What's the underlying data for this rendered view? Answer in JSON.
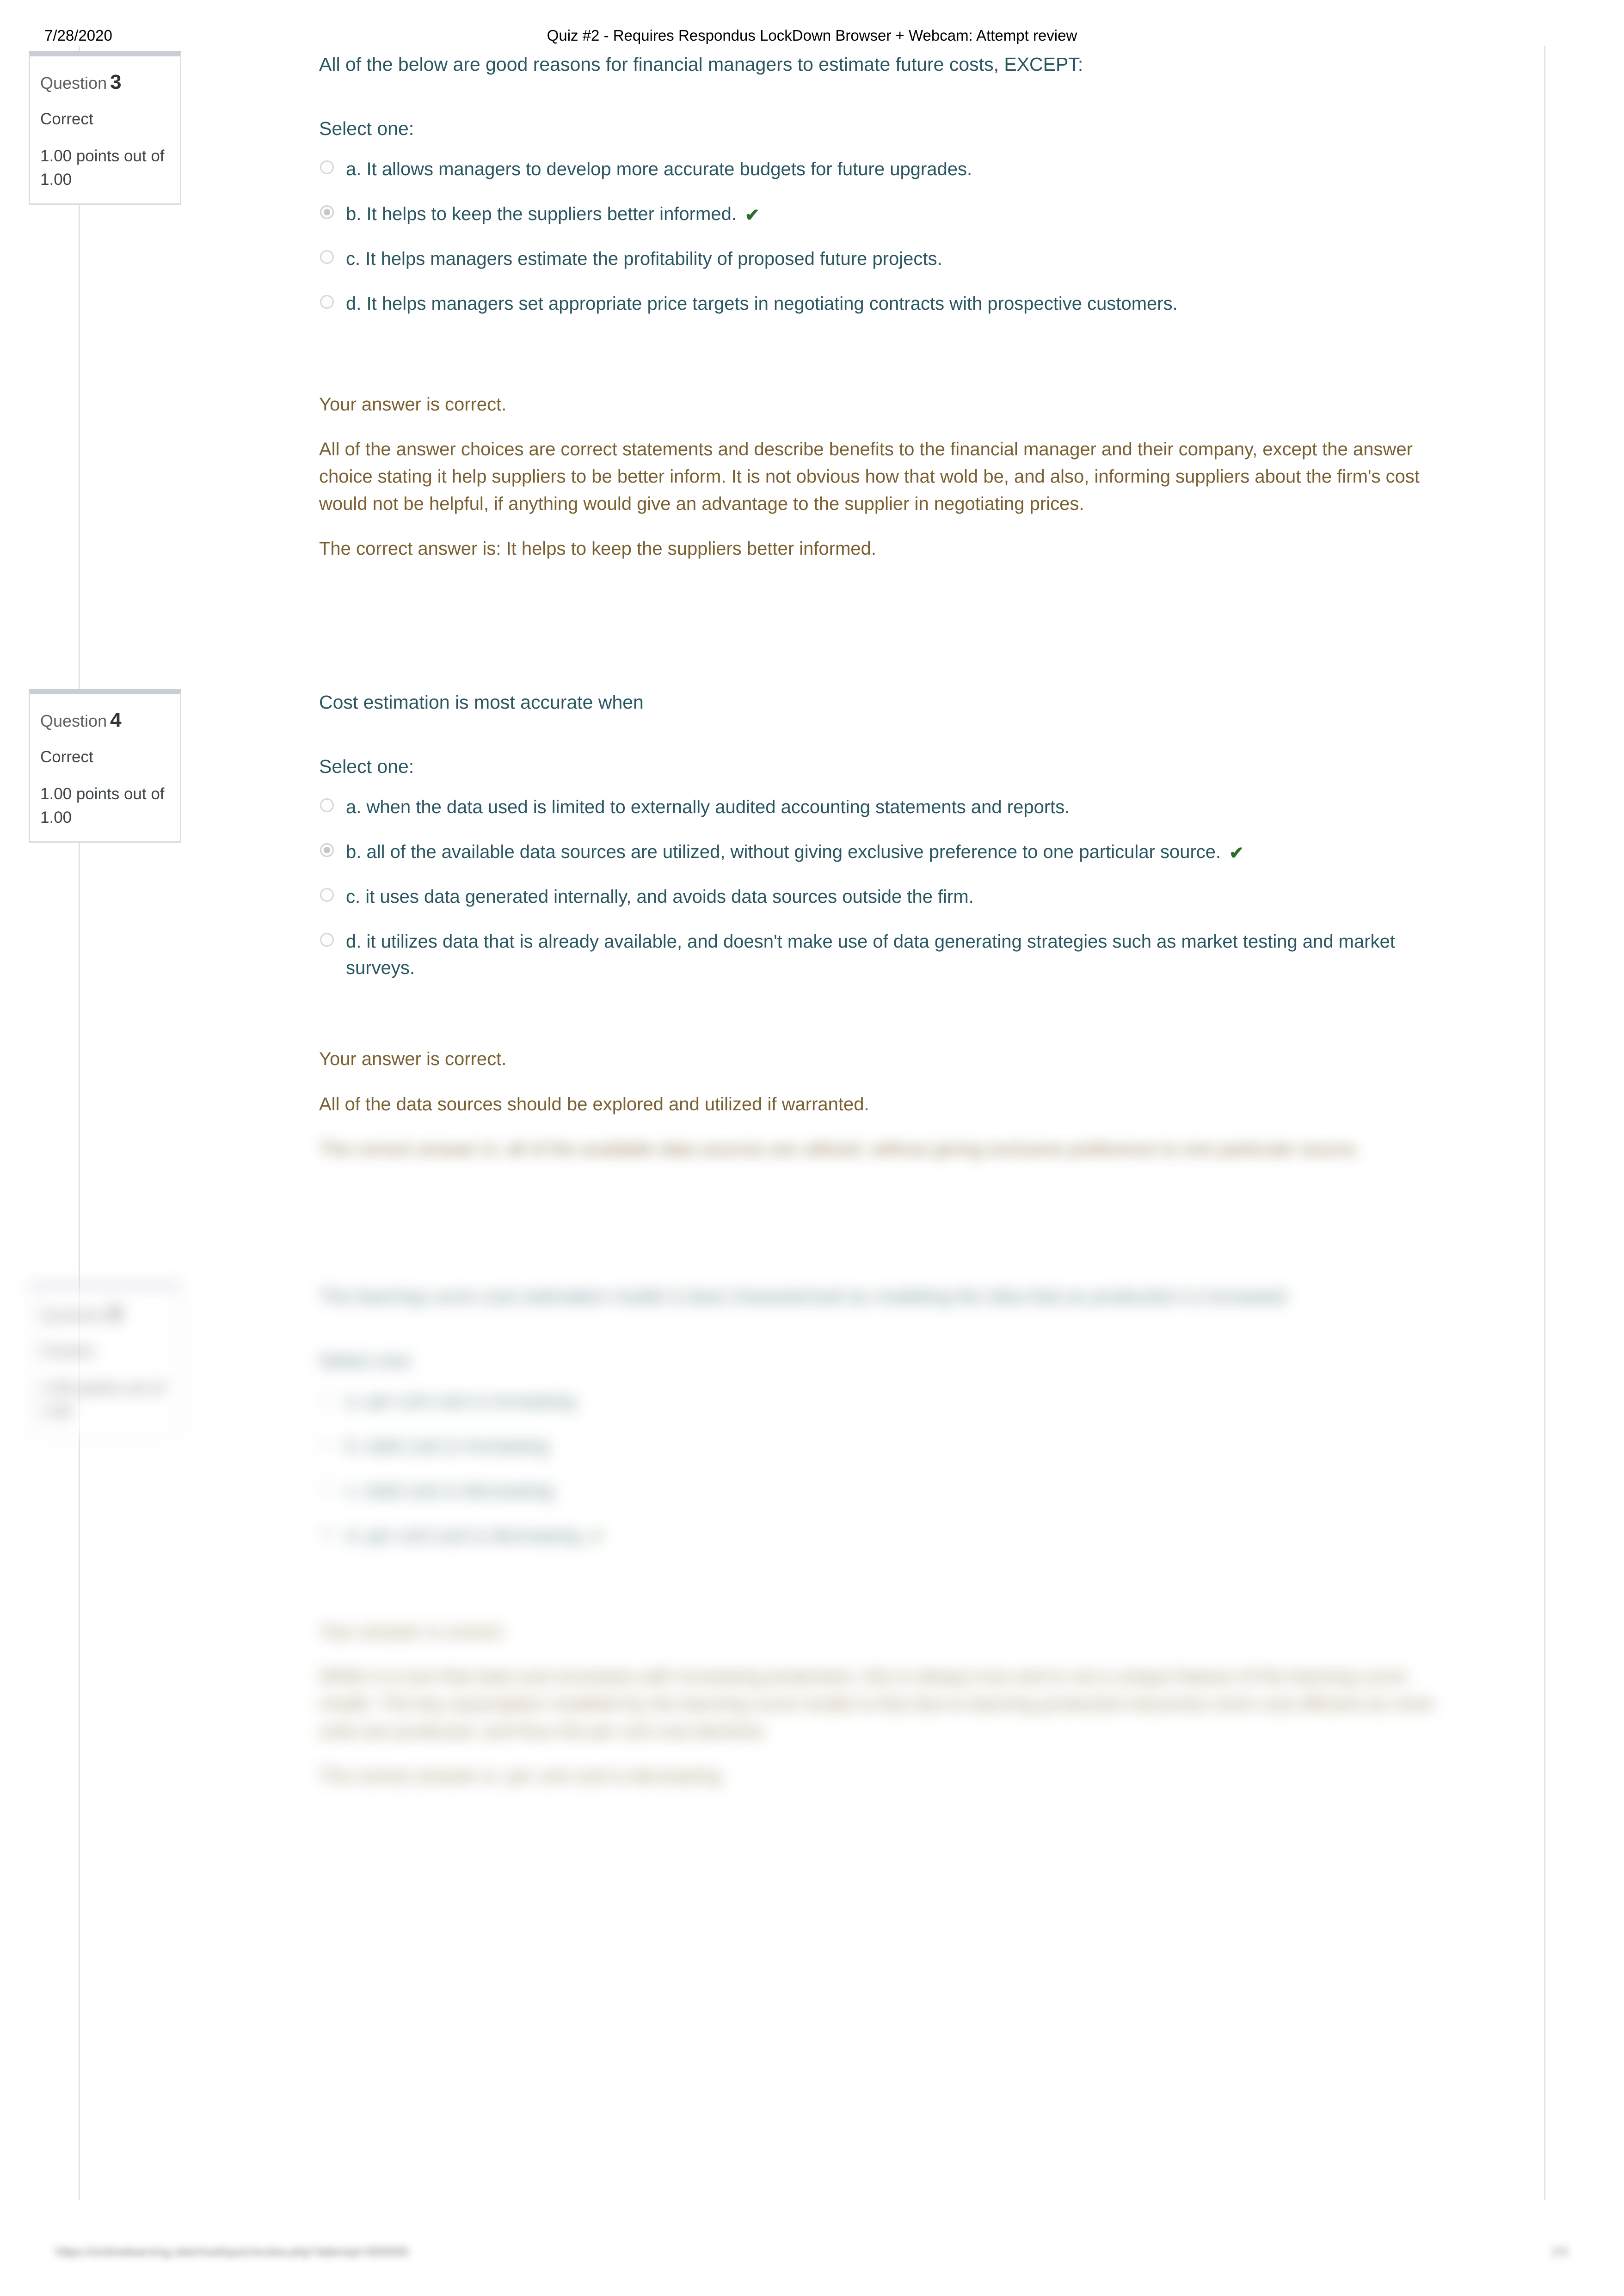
{
  "print_header": {
    "date": "7/28/2020",
    "title": "Quiz #2 - Requires Respondus LockDown Browser + Webcam: Attempt review"
  },
  "print_footer": {
    "url": "https://onlinelearning.site/mod/quiz/review.php?attempt=000000",
    "page": "2/5"
  },
  "labels": {
    "select_one": "Select one:",
    "question_word": "Question",
    "checkmark": "✔"
  },
  "questions": [
    {
      "number": "3",
      "state": "Correct",
      "grade": "1.00 points out of 1.00",
      "text": "All of the below are good reasons for financial managers to estimate future costs, EXCEPT:",
      "select_one": "Select one:",
      "options": [
        {
          "label": "a. It allows managers to develop more accurate budgets for future upgrades.",
          "selected": false,
          "correct_mark": false
        },
        {
          "label": "b. It helps to keep the suppliers better informed.",
          "selected": true,
          "correct_mark": true
        },
        {
          "label": "c. It helps managers estimate the profitability of proposed future projects.",
          "selected": false,
          "correct_mark": false
        },
        {
          "label": "d. It helps managers set appropriate price targets in negotiating contracts with prospective customers.",
          "selected": false,
          "correct_mark": false
        }
      ],
      "feedback": [
        "Your answer is correct.",
        "All of the answer choices are correct statements and describe benefits to the financial manager and their company, except the answer choice stating it help suppliers to be better inform. It is not obvious how that wold be, and also, informing suppliers about the firm's cost would not be helpful, if anything would give an advantage to the supplier in negotiating prices.",
        "The correct answer is: It helps to keep the suppliers better informed."
      ]
    },
    {
      "number": "4",
      "state": "Correct",
      "grade": "1.00 points out of 1.00",
      "text": "Cost estimation is most accurate when",
      "select_one": "Select one:",
      "options": [
        {
          "label": "a. when the data used is limited to externally audited accounting statements and reports.",
          "selected": false,
          "correct_mark": false
        },
        {
          "label": "b. all of the available data sources are utilized, without giving exclusive preference to one particular source.",
          "selected": true,
          "correct_mark": true
        },
        {
          "label": "c. it uses data generated internally, and avoids data sources outside the firm.",
          "selected": false,
          "correct_mark": false
        },
        {
          "label": "d. it utilizes data that is already available, and doesn't make use of data generating strategies such as market testing and market surveys.",
          "selected": false,
          "correct_mark": false
        }
      ],
      "feedback": [
        "Your answer is correct.",
        "All of the data sources should be explored and utilized if warranted.",
        "The correct answer is: all of the available data sources are utilized, without giving exclusive preference to one particular source."
      ]
    },
    {
      "number": "5",
      "state": "Correct",
      "grade": "1.00 points out of 1.00",
      "text": "The learning curve cost estimation model is best characterized as modeling the idea that as production is increased",
      "select_one": "Select one:",
      "options": [
        {
          "label": "a. per unit cost is increasing",
          "selected": false,
          "correct_mark": false
        },
        {
          "label": "b. total cost is increasing",
          "selected": false,
          "correct_mark": false
        },
        {
          "label": "c. total cost is decreasing",
          "selected": false,
          "correct_mark": false
        },
        {
          "label": "d. per unit cost is decreasing",
          "selected": true,
          "correct_mark": true
        }
      ],
      "feedback": [
        "Your answer is correct.",
        "While it is true that total cost increases with increasing production, this is always true and is not a unique feature of the learning curve model. The key assumption modeled by the learning curve model is that due to learning production becomes more cost efficient as more units are produced, and thus the per unit cost declines.",
        "The correct answer is: per unit cost is decreasing"
      ]
    }
  ]
}
